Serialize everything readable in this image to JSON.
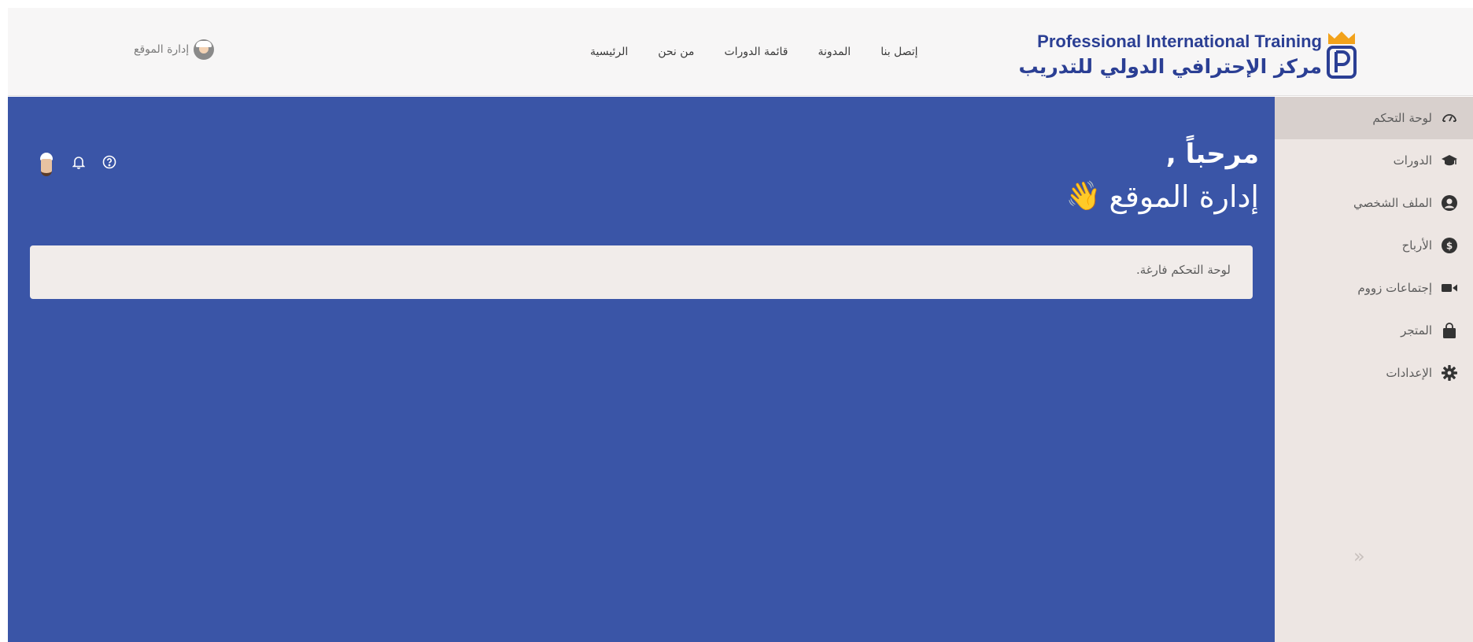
{
  "header": {
    "brand_en": "Professional International Training",
    "brand_ar": "مركز الإحترافي الدولي للتدريب",
    "nav": [
      {
        "label": "الرئيسية"
      },
      {
        "label": "من نحن"
      },
      {
        "label": "قائمة الدورات"
      },
      {
        "label": "المدونة"
      },
      {
        "label": "إتصل بنا"
      }
    ],
    "user_label": "إدارة الموقع"
  },
  "main": {
    "greeting": "مرحباً ,",
    "user_name": "إدارة الموقع",
    "wave_emoji": "👋",
    "empty_message": "لوحة التحكم فارغة."
  },
  "toolbar": {
    "help_icon": "help-circle-icon",
    "bell_icon": "bell-icon"
  },
  "sidebar": {
    "items": [
      {
        "label": "لوحة التحكم",
        "icon": "dashboard-gauge-icon"
      },
      {
        "label": "الدورات",
        "icon": "graduation-cap-icon"
      },
      {
        "label": "الملف الشخصي",
        "icon": "user-circle-icon"
      },
      {
        "label": "الأرباح",
        "icon": "dollar-coin-icon"
      },
      {
        "label": "إجتماعات زووم",
        "icon": "video-camera-icon"
      },
      {
        "label": "المتجر",
        "icon": "shopping-bag-icon"
      },
      {
        "label": "الإعدادات",
        "icon": "gear-icon"
      }
    ],
    "collapse_icon": "double-chevron-icon"
  },
  "colors": {
    "brand_blue": "#2b3f94",
    "main_bg": "#3a55a7",
    "sidebar_bg": "#ede6e3",
    "sidebar_active": "#d8d0cd",
    "empty_box_bg": "#f1ecea"
  }
}
